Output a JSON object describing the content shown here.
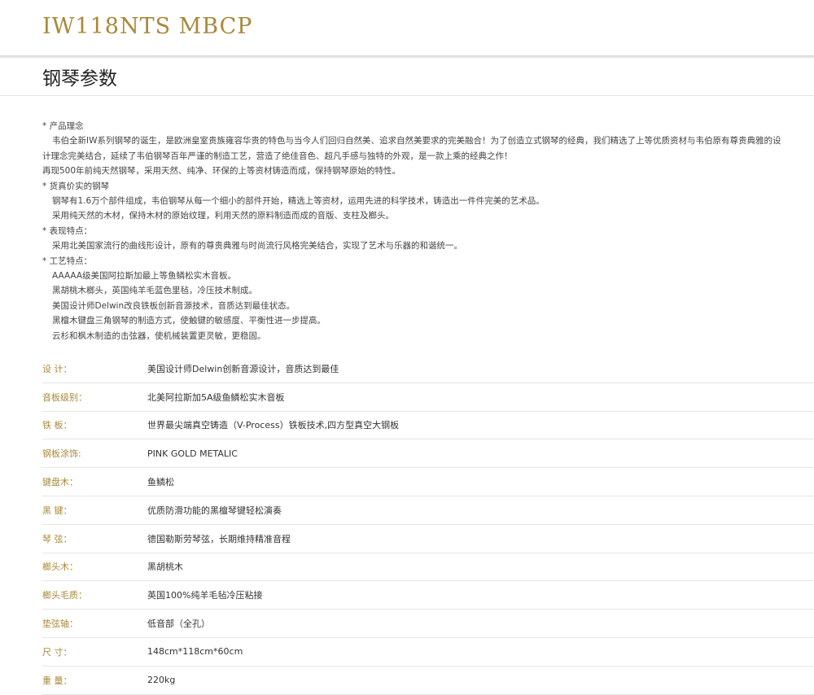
{
  "header": {
    "model": "IW118NTS MBCP"
  },
  "section": {
    "title": "钢琴参数"
  },
  "intro": {
    "line1_head": "*  产品理念",
    "line2": "韦伯全新IW系列钢琴的诞生，是欧洲皇室贵族雍容华贵的特色与当今人们回归自然美、追求自然美要求的完美融合！为了创造立式钢琴的经典，我们精选了上等优质资材与韦伯原有尊贵典雅的设",
    "line3": "计理念完美结合，延续了韦伯钢琴百年严谨的制造工艺，营造了绝佳音色、超凡手感与独特的外观，是一款上乘的经典之作！",
    "line4": "再现500年前纯天然钢琴，采用天然、纯净、环保的上等资材铸造而成，保持钢琴原始的特性。",
    "line5_head": "*  货真价实的钢琴",
    "line6": "钢琴有1.6万个部件组成，韦伯钢琴从每一个细小的部件开始，精选上等资材，运用先进的科学技术，铸造出一件件完美的艺术品。",
    "line7": "采用纯天然的木材，保持木材的原始纹理，利用天然的原料制造而成的音版、支柱及榔头。",
    "line8_head": "*  表现特点：",
    "line9": "采用北美国家流行的曲线形设计，原有的尊贵典雅与时尚流行风格完美结合，实现了艺术与乐器的和谐统一。",
    "line10_head": "*  工艺特点：",
    "line11": "AAAAA级美国阿拉斯加最上等鱼鳞松实木音板。",
    "line12": "黑胡桃木榔头，英国纯羊毛蓝色里毡，冷压技术制成。",
    "line13": "美国设计师Delwin改良铁板创新音源技术，音质达到最佳状态。",
    "line14": "黑檀木键盘三角钢琴的制造方式，使触键的敏感度、平衡性进一步提高。",
    "line15": "云杉和枫木制造的击弦器，使机械装置更灵敏，更稳固。"
  },
  "specs": [
    {
      "label": "设 计：",
      "value": "美国设计师Delwin创新音源设计，音质达到最佳"
    },
    {
      "label": "音板级别：",
      "value": "北美阿拉斯加5A级鱼鳞松实木音板"
    },
    {
      "label": "铁 板：",
      "value": "世界最尖端真空铸造（V-Process）铁板技术,四方型真空大钢板"
    },
    {
      "label": "钢板涂饰:",
      "value": "PINK GOLD METALIC"
    },
    {
      "label": "键盘木：",
      "value": "鱼鳞松"
    },
    {
      "label": "黑 键：",
      "value": "优质防滑功能的黑檀琴键轻松演奏"
    },
    {
      "label": "琴 弦：",
      "value": "德国勒斯劳琴弦，长期维持精准音程"
    },
    {
      "label": "榔头木：",
      "value": "黑胡桃木"
    },
    {
      "label": "榔头毛质：",
      "value": "英国100%纯羊毛毡冷压粘接"
    },
    {
      "label": "垫弦轴：",
      "value": "低音部（全孔）"
    },
    {
      "label": "尺 寸：",
      "value": "148cm*118cm*60cm"
    },
    {
      "label": "重 量：",
      "value": "220kg"
    }
  ],
  "colors": {
    "accent_gold": "#a8893a",
    "text": "#333333"
  }
}
